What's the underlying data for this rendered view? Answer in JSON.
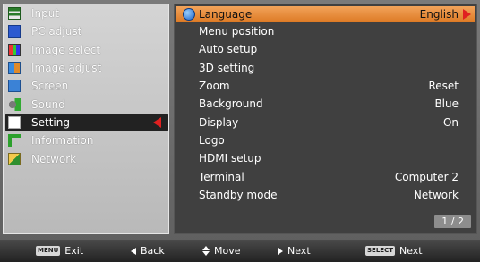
{
  "left_menu": {
    "items": [
      {
        "label": "Input",
        "icon": "input-icon"
      },
      {
        "label": "PC adjust",
        "icon": "pc-adjust-icon"
      },
      {
        "label": "Image select",
        "icon": "image-select-icon"
      },
      {
        "label": "Image adjust",
        "icon": "image-adjust-icon"
      },
      {
        "label": "Screen",
        "icon": "screen-icon"
      },
      {
        "label": "Sound",
        "icon": "sound-icon"
      },
      {
        "label": "Setting",
        "icon": "setting-icon",
        "selected": true
      },
      {
        "label": "Information",
        "icon": "information-icon"
      },
      {
        "label": "Network",
        "icon": "network-icon"
      }
    ]
  },
  "settings": {
    "items": [
      {
        "label": "Language",
        "value": "English",
        "highlighted": true
      },
      {
        "label": "Menu position",
        "value": ""
      },
      {
        "label": "Auto setup",
        "value": ""
      },
      {
        "label": "3D setting",
        "value": ""
      },
      {
        "label": "Zoom",
        "value": "Reset"
      },
      {
        "label": "Background",
        "value": "Blue"
      },
      {
        "label": "Display",
        "value": "On"
      },
      {
        "label": "Logo",
        "value": ""
      },
      {
        "label": "HDMI setup",
        "value": ""
      },
      {
        "label": "Terminal",
        "value": "Computer 2"
      },
      {
        "label": "Standby mode",
        "value": "Network"
      }
    ],
    "page": "1 / 2"
  },
  "bottom_bar": {
    "exit_key": "MENU",
    "exit_label": "Exit",
    "back_label": "Back",
    "move_label": "Move",
    "next_label": "Next",
    "select_key": "SELECT",
    "select_next_label": "Next"
  },
  "colors": {
    "highlight": "#e88a38",
    "selected_bg": "#222222",
    "arrow": "#e02020"
  }
}
